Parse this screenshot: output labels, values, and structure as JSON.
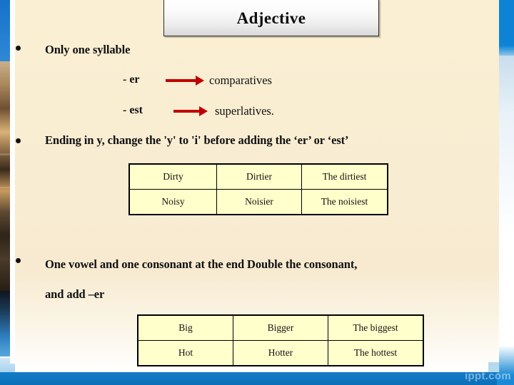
{
  "slide": {
    "title": "Adjective",
    "watermark": "ippt.com",
    "bullets": [
      {
        "text": "Only one syllable"
      },
      {
        "text": "Ending in y, change the 'y' to 'i' before adding the ‘er’ or ‘est’"
      },
      {
        "text": "One vowel and one consonant at the end Double the consonant,"
      }
    ],
    "bullet3_line2": "and add –er",
    "rules": [
      {
        "suffix": "- er",
        "arrow": "right-arrow-icon",
        "result": "comparatives"
      },
      {
        "suffix": "- est",
        "arrow": "right-arrow-icon",
        "result": "superlatives."
      }
    ],
    "tables": [
      {
        "name": "y-to-i-table",
        "rows": [
          [
            "Dirty",
            "Dirtier",
            "The dirtiest"
          ],
          [
            "Noisy",
            "Noisier",
            "The noisiest"
          ]
        ]
      },
      {
        "name": "double-consonant-table",
        "rows": [
          [
            "Big",
            "Bigger",
            "The biggest"
          ],
          [
            "Hot",
            "Hotter",
            "The hottest"
          ]
        ]
      }
    ],
    "colors": {
      "background": "#f8ecd2",
      "table_fill": "#ffffcc",
      "arrow": "#C00000",
      "accent_blue": "#0e83d6",
      "text": "#101010"
    }
  }
}
